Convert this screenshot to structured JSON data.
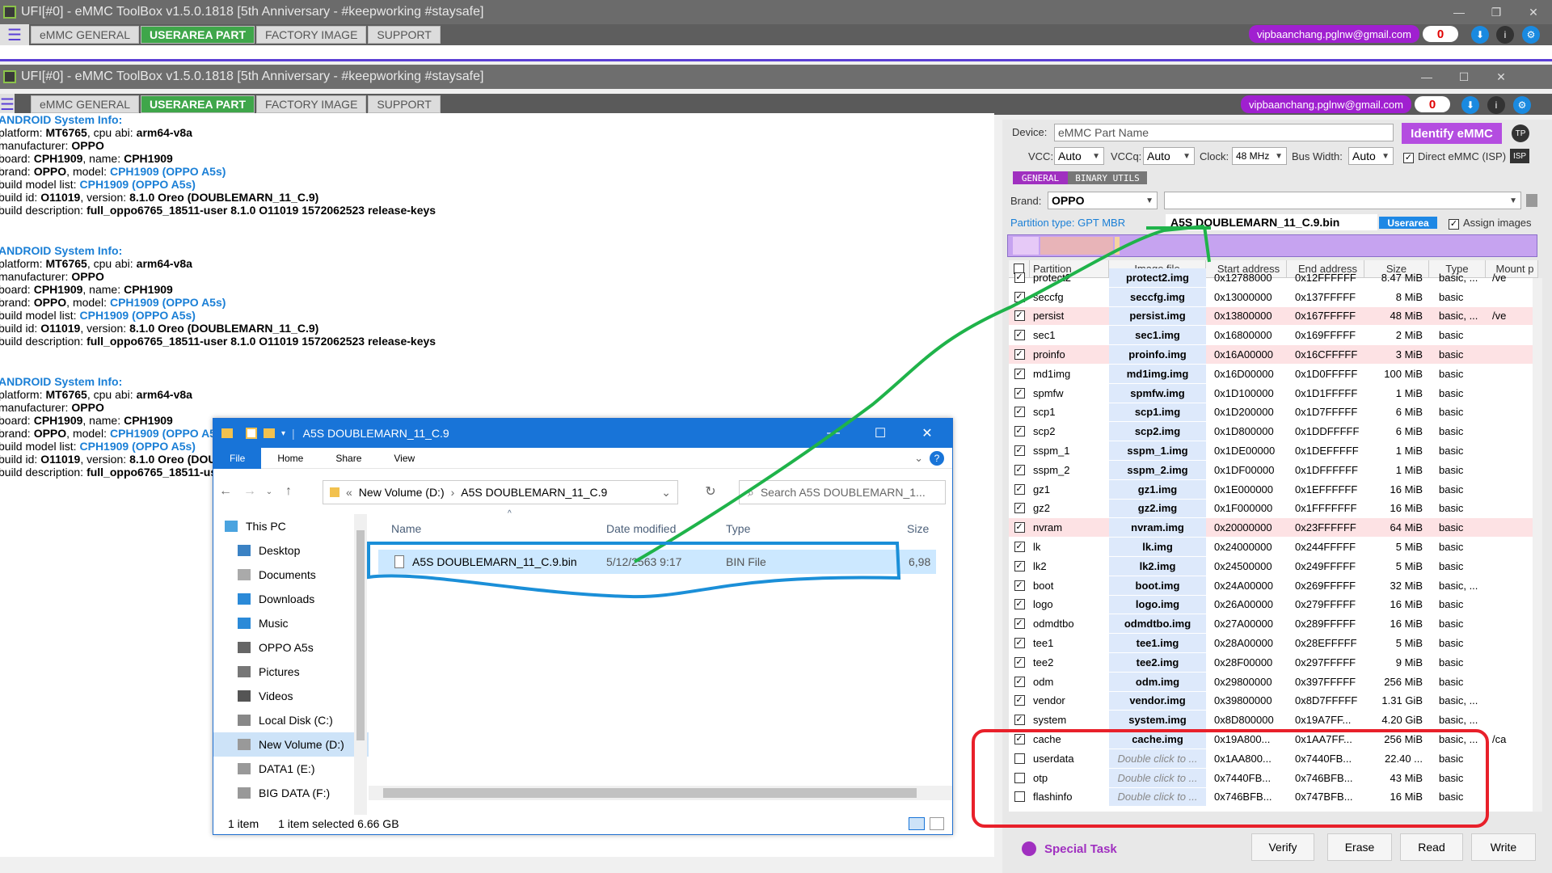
{
  "back_window": {
    "title": "UFI[#0] - eMMC ToolBox v1.5.0.1818 [5th Anniversary - #keepworking #staysafe]",
    "tabs": [
      "eMMC GENERAL",
      "USERAREA PART",
      "FACTORY IMAGE",
      "SUPPORT"
    ],
    "email": "vipbaanchang.pglnw@gmail.com",
    "counter": "0"
  },
  "front_window": {
    "title": "UFI[#0] - eMMC ToolBox v1.5.0.1818 [5th Anniversary - #keepworking #staysafe]",
    "tabs": [
      "eMMC GENERAL",
      "USERAREA PART",
      "FACTORY IMAGE",
      "SUPPORT"
    ],
    "active_tab": "USERAREA PART",
    "email": "vipbaanchang.pglnw@gmail.com",
    "counter": "0"
  },
  "android_info": {
    "header": "ANDROID System Info:",
    "platform_label": "platform:",
    "platform": "MT6765",
    "cpu_label": ", cpu abi:",
    "cpu": "arm64-v8a",
    "manufacturer_label": "manufacturer:",
    "manufacturer": "OPPO",
    "board_label": "board:",
    "board": "CPH1909",
    "name_label": ", name:",
    "name": "CPH1909",
    "brand_label": "brand:",
    "brand": "OPPO",
    "model_label": ", model:",
    "model": "CPH1909 (OPPO A5s)",
    "modellist_label": "build model list:",
    "modellist": "CPH1909 (OPPO A5s)",
    "buildid_label": "build id:",
    "buildid": "O11019",
    "version_label": ", version:",
    "version": "8.1.0 Oreo (DOUBLEMARN_11_C.9)",
    "desc_label": "build description:",
    "desc": "full_oppo6765_18511-user 8.1.0 O11019 1572062523 release-keys"
  },
  "right_panel": {
    "device_label": "Device:",
    "device_placeholder": "eMMC Part Name",
    "identify_button": "Identify eMMC",
    "tp_label": "TP",
    "vcc_label": "VCC:",
    "vcc": "Auto",
    "vccq_label": "VCCq:",
    "vccq": "Auto",
    "clock_label": "Clock:",
    "clock": "48 MHz",
    "buswidth_label": "Bus Width:",
    "buswidth": "Auto",
    "direct_label": "Direct eMMC (ISP)",
    "isp_label": "ISP",
    "subtab_general": "GENERAL",
    "subtab_binary": "BINARY UTILS",
    "brand_label": "Brand:",
    "brand": "OPPO",
    "partition_type": "Partition type: GPT MBR",
    "loaded_file": "A5S DOUBLEMARN_11_C.9.bin",
    "userarea_badge": "Userarea",
    "assign_label": "Assign images",
    "special_task": "Special Task",
    "buttons": [
      "Verify",
      "Erase",
      "Read",
      "Write"
    ]
  },
  "partition_table": {
    "columns": [
      "Partition",
      "Image file",
      "Start address",
      "End address",
      "Size",
      "Type",
      "Mount p"
    ],
    "rows": [
      {
        "checked": true,
        "pink": false,
        "name": "protect2",
        "image": "protect2.img",
        "start": "0x12788000",
        "end": "0x12FFFFFF",
        "size": "8.47 MiB",
        "type": "basic, ...",
        "mount": "/ve"
      },
      {
        "checked": true,
        "pink": false,
        "name": "seccfg",
        "image": "seccfg.img",
        "start": "0x13000000",
        "end": "0x137FFFFF",
        "size": "8 MiB",
        "type": "basic",
        "mount": ""
      },
      {
        "checked": true,
        "pink": true,
        "name": "persist",
        "image": "persist.img",
        "start": "0x13800000",
        "end": "0x167FFFFF",
        "size": "48 MiB",
        "type": "basic, ...",
        "mount": "/ve"
      },
      {
        "checked": true,
        "pink": false,
        "name": "sec1",
        "image": "sec1.img",
        "start": "0x16800000",
        "end": "0x169FFFFF",
        "size": "2 MiB",
        "type": "basic",
        "mount": ""
      },
      {
        "checked": true,
        "pink": true,
        "name": "proinfo",
        "image": "proinfo.img",
        "start": "0x16A00000",
        "end": "0x16CFFFFF",
        "size": "3 MiB",
        "type": "basic",
        "mount": ""
      },
      {
        "checked": true,
        "pink": false,
        "name": "md1img",
        "image": "md1img.img",
        "start": "0x16D00000",
        "end": "0x1D0FFFFF",
        "size": "100 MiB",
        "type": "basic",
        "mount": ""
      },
      {
        "checked": true,
        "pink": false,
        "name": "spmfw",
        "image": "spmfw.img",
        "start": "0x1D100000",
        "end": "0x1D1FFFFF",
        "size": "1 MiB",
        "type": "basic",
        "mount": ""
      },
      {
        "checked": true,
        "pink": false,
        "name": "scp1",
        "image": "scp1.img",
        "start": "0x1D200000",
        "end": "0x1D7FFFFF",
        "size": "6 MiB",
        "type": "basic",
        "mount": ""
      },
      {
        "checked": true,
        "pink": false,
        "name": "scp2",
        "image": "scp2.img",
        "start": "0x1D800000",
        "end": "0x1DDFFFFF",
        "size": "6 MiB",
        "type": "basic",
        "mount": ""
      },
      {
        "checked": true,
        "pink": false,
        "name": "sspm_1",
        "image": "sspm_1.img",
        "start": "0x1DE00000",
        "end": "0x1DEFFFFF",
        "size": "1 MiB",
        "type": "basic",
        "mount": ""
      },
      {
        "checked": true,
        "pink": false,
        "name": "sspm_2",
        "image": "sspm_2.img",
        "start": "0x1DF00000",
        "end": "0x1DFFFFFF",
        "size": "1 MiB",
        "type": "basic",
        "mount": ""
      },
      {
        "checked": true,
        "pink": false,
        "name": "gz1",
        "image": "gz1.img",
        "start": "0x1E000000",
        "end": "0x1EFFFFFF",
        "size": "16 MiB",
        "type": "basic",
        "mount": ""
      },
      {
        "checked": true,
        "pink": false,
        "name": "gz2",
        "image": "gz2.img",
        "start": "0x1F000000",
        "end": "0x1FFFFFFF",
        "size": "16 MiB",
        "type": "basic",
        "mount": ""
      },
      {
        "checked": true,
        "pink": true,
        "name": "nvram",
        "image": "nvram.img",
        "start": "0x20000000",
        "end": "0x23FFFFFF",
        "size": "64 MiB",
        "type": "basic",
        "mount": ""
      },
      {
        "checked": true,
        "pink": false,
        "name": "lk",
        "image": "lk.img",
        "start": "0x24000000",
        "end": "0x244FFFFF",
        "size": "5 MiB",
        "type": "basic",
        "mount": ""
      },
      {
        "checked": true,
        "pink": false,
        "name": "lk2",
        "image": "lk2.img",
        "start": "0x24500000",
        "end": "0x249FFFFF",
        "size": "5 MiB",
        "type": "basic",
        "mount": ""
      },
      {
        "checked": true,
        "pink": false,
        "name": "boot",
        "image": "boot.img",
        "start": "0x24A00000",
        "end": "0x269FFFFF",
        "size": "32 MiB",
        "type": "basic, ...",
        "mount": ""
      },
      {
        "checked": true,
        "pink": false,
        "name": "logo",
        "image": "logo.img",
        "start": "0x26A00000",
        "end": "0x279FFFFF",
        "size": "16 MiB",
        "type": "basic",
        "mount": ""
      },
      {
        "checked": true,
        "pink": false,
        "name": "odmdtbo",
        "image": "odmdtbo.img",
        "start": "0x27A00000",
        "end": "0x289FFFFF",
        "size": "16 MiB",
        "type": "basic",
        "mount": ""
      },
      {
        "checked": true,
        "pink": false,
        "name": "tee1",
        "image": "tee1.img",
        "start": "0x28A00000",
        "end": "0x28EFFFFF",
        "size": "5 MiB",
        "type": "basic",
        "mount": ""
      },
      {
        "checked": true,
        "pink": false,
        "name": "tee2",
        "image": "tee2.img",
        "start": "0x28F00000",
        "end": "0x297FFFFF",
        "size": "9 MiB",
        "type": "basic",
        "mount": ""
      },
      {
        "checked": true,
        "pink": false,
        "name": "odm",
        "image": "odm.img",
        "start": "0x29800000",
        "end": "0x397FFFFF",
        "size": "256 MiB",
        "type": "basic",
        "mount": ""
      },
      {
        "checked": true,
        "pink": false,
        "name": "vendor",
        "image": "vendor.img",
        "start": "0x39800000",
        "end": "0x8D7FFFFF",
        "size": "1.31 GiB",
        "type": "basic, ...",
        "mount": ""
      },
      {
        "checked": true,
        "pink": false,
        "name": "system",
        "image": "system.img",
        "start": "0x8D800000",
        "end": "0x19A7FF...",
        "size": "4.20 GiB",
        "type": "basic, ...",
        "mount": ""
      },
      {
        "checked": true,
        "pink": false,
        "name": "cache",
        "image": "cache.img",
        "start": "0x19A800...",
        "end": "0x1AA7FF...",
        "size": "256 MiB",
        "type": "basic, ...",
        "mount": "/ca"
      },
      {
        "checked": false,
        "pink": false,
        "name": "userdata",
        "image": "Double click to ...",
        "start": "0x1AA800...",
        "end": "0x7440FB...",
        "size": "22.40 ...",
        "type": "basic",
        "mount": ""
      },
      {
        "checked": false,
        "pink": false,
        "name": "otp",
        "image": "Double click to ...",
        "start": "0x7440FB...",
        "end": "0x746BFB...",
        "size": "43 MiB",
        "type": "basic",
        "mount": ""
      },
      {
        "checked": false,
        "pink": false,
        "name": "flashinfo",
        "image": "Double click to ...",
        "start": "0x746BFB...",
        "end": "0x747BFB...",
        "size": "16 MiB",
        "type": "basic",
        "mount": ""
      }
    ]
  },
  "explorer": {
    "title": "A5S DOUBLEMARN_11_C.9",
    "ribbon_tabs": [
      "File",
      "Home",
      "Share",
      "View"
    ],
    "address_prefix": "«",
    "address_drive": "New Volume (D:)",
    "address_folder": "A5S DOUBLEMARN_11_C.9",
    "search_placeholder": "Search A5S DOUBLEMARN_1...",
    "nav_items": [
      "This PC",
      "Desktop",
      "Documents",
      "Downloads",
      "Music",
      "OPPO A5s",
      "Pictures",
      "Videos",
      "Local Disk (C:)",
      "New Volume (D:)",
      "DATA1 (E:)",
      "BIG DATA (F:)"
    ],
    "selected_nav": "New Volume (D:)",
    "columns": [
      "Name",
      "Date modified",
      "Type",
      "Size"
    ],
    "file": {
      "name": "A5S DOUBLEMARN_11_C.9.bin",
      "date": "5/12/2563 9:17",
      "type": "BIN File",
      "size": "6,98"
    },
    "status_count": "1 item",
    "status_selected": "1 item selected  6.66 GB"
  }
}
